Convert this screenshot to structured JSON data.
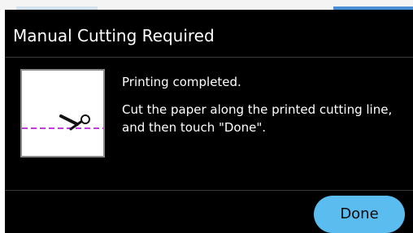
{
  "dialog": {
    "title": "Manual Cutting Required",
    "message_line1": "Printing completed.",
    "message_line2": "Cut the paper along the printed cutting line,",
    "message_line3": "and then touch \"Done\".",
    "done_label": "Done"
  },
  "illustration": {
    "icon": "scissors-icon",
    "cut_line_color": "#c03cdc",
    "paper_color": "#ffffff"
  },
  "colors": {
    "dialog_background": "#000000",
    "button_background": "#5bbcef",
    "text": "#ffffff"
  }
}
